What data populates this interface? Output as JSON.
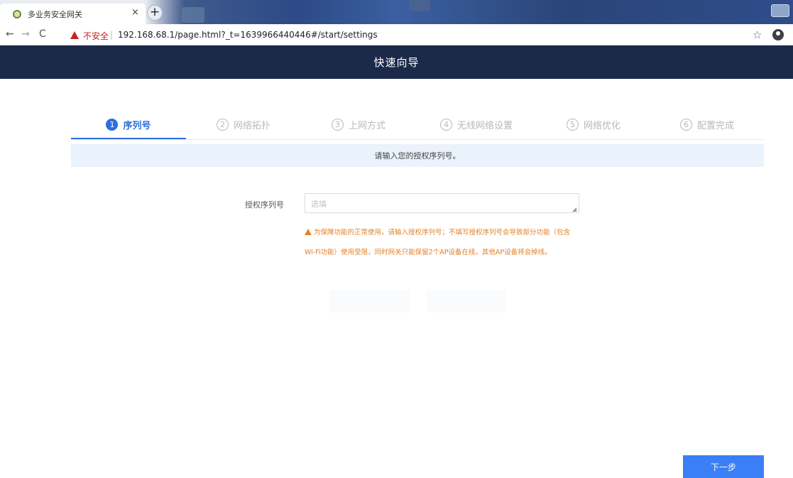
{
  "browser": {
    "tab_title": "多业务安全网关",
    "tab_close": "×",
    "new_tab": "+",
    "nav": {
      "back": "←",
      "forward": "→",
      "reload": "C"
    },
    "security_label": "不安全",
    "address_separator": "|",
    "url": "192.168.68.1/page.html?_t=1639966440446#/start/settings",
    "star": "☆"
  },
  "header": {
    "title": "快速向导"
  },
  "steps": [
    {
      "num": "1",
      "label": "序列号",
      "active": true
    },
    {
      "num": "2",
      "label": "网络拓扑",
      "active": false
    },
    {
      "num": "3",
      "label": "上网方式",
      "active": false
    },
    {
      "num": "4",
      "label": "无线网络设置",
      "active": false
    },
    {
      "num": "5",
      "label": "网络优化",
      "active": false
    },
    {
      "num": "6",
      "label": "配置完成",
      "active": false
    }
  ],
  "info_banner": "请输入您的授权序列号。",
  "form": {
    "label": "授权序列号",
    "placeholder": "选填",
    "value": "",
    "warning_line1": "为保障功能的正常使用，请输入授权序列号；不填写授权序列号会导致部分功能（包含",
    "warning_line2": "Wi-Fi功能）使用受限，同时网关只能保留2个AP设备在线，其他AP设备将会掉线。"
  },
  "buttons": {
    "next": "下一步"
  },
  "colors": {
    "header_bg": "#1c2a4a",
    "accent": "#2b6fe0",
    "warning": "#e0832a",
    "banner_bg": "#eaf2fb"
  }
}
